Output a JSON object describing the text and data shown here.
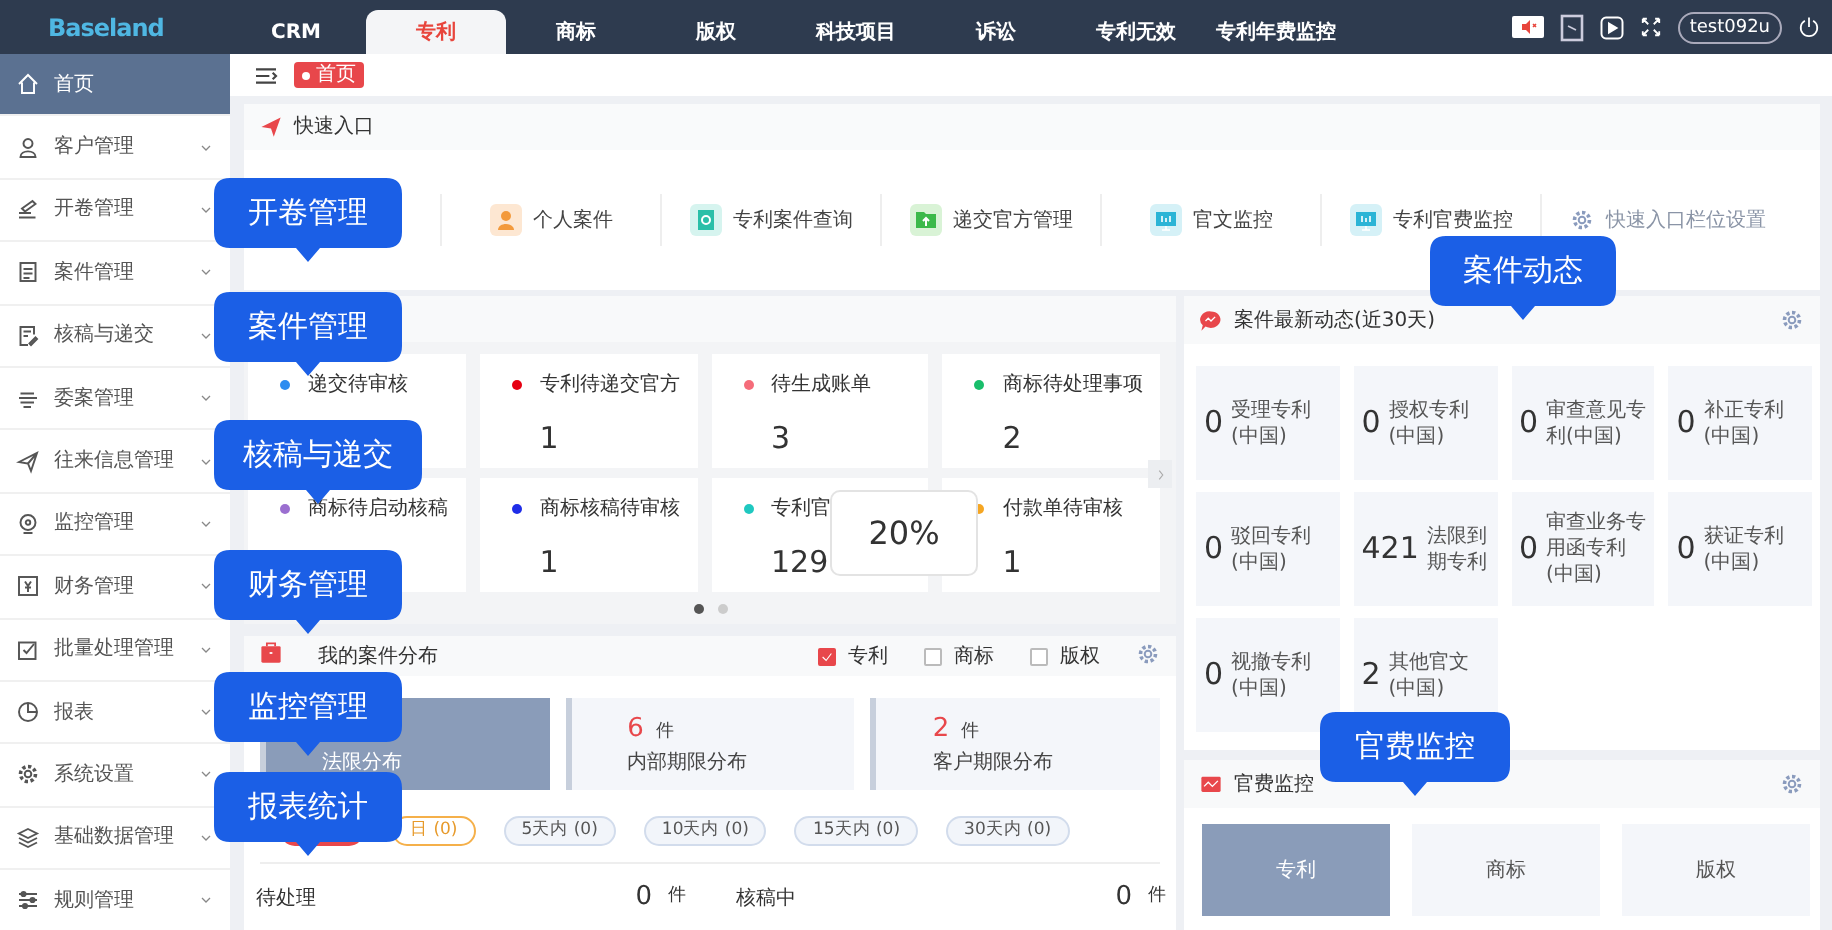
{
  "app": {
    "logo": "Baseland",
    "user": "test092u"
  },
  "top_tabs": [
    {
      "label": "CRM",
      "selected": false
    },
    {
      "label": "专利",
      "selected": true
    },
    {
      "label": "商标",
      "selected": false
    },
    {
      "label": "版权",
      "selected": false
    },
    {
      "label": "科技项目",
      "selected": false
    },
    {
      "label": "诉讼",
      "selected": false
    },
    {
      "label": "专利无效",
      "selected": false
    },
    {
      "label": "专利年费监控",
      "selected": false
    }
  ],
  "sidebar": [
    {
      "label": "首页",
      "selected": true,
      "has_submenu": false
    },
    {
      "label": "客户管理",
      "selected": false,
      "has_submenu": true
    },
    {
      "label": "开卷管理",
      "selected": false,
      "has_submenu": true
    },
    {
      "label": "案件管理",
      "selected": false,
      "has_submenu": true
    },
    {
      "label": "核稿与递交",
      "selected": false,
      "has_submenu": true
    },
    {
      "label": "委案管理",
      "selected": false,
      "has_submenu": true
    },
    {
      "label": "往来信息管理",
      "selected": false,
      "has_submenu": true
    },
    {
      "label": "监控管理",
      "selected": false,
      "has_submenu": true
    },
    {
      "label": "财务管理",
      "selected": false,
      "has_submenu": true
    },
    {
      "label": "批量处理管理",
      "selected": false,
      "has_submenu": true
    },
    {
      "label": "报表",
      "selected": false,
      "has_submenu": true
    },
    {
      "label": "系统设置",
      "selected": false,
      "has_submenu": true
    },
    {
      "label": "基础数据管理",
      "selected": false,
      "has_submenu": true
    },
    {
      "label": "规则管理",
      "selected": false,
      "has_submenu": true
    }
  ],
  "page_tag": "首页",
  "quick_entry": {
    "title": "快速入口",
    "items": [
      {
        "label": "个人案件",
        "kind": "person"
      },
      {
        "label": "专利案件查询",
        "kind": "search"
      },
      {
        "label": "递交官方管理",
        "kind": "folder"
      },
      {
        "label": "官文监控",
        "kind": "monitor"
      },
      {
        "label": "专利官费监控",
        "kind": "monitor"
      }
    ],
    "settings": "快速入口栏位设置"
  },
  "todo": {
    "cards": [
      {
        "label": "递交待审核",
        "color": "#2d8cf0"
      },
      {
        "label": "专利待递交官方",
        "color": "#e60012",
        "value": "1"
      },
      {
        "label": "待生成账单",
        "color": "#f56c7a",
        "value": "3"
      },
      {
        "label": "商标待处理事项",
        "color": "#19be6b",
        "value": "2"
      },
      {
        "label": "商标待启动核稿",
        "color": "#9b6fd0"
      },
      {
        "label": "商标核稿待审核",
        "color": "#1f2de8",
        "value": "1"
      },
      {
        "label": "专利官",
        "color": "#1fc8c0",
        "value": "129"
      },
      {
        "label": "付款单待审核",
        "color": "#f5a623",
        "value": "1"
      }
    ],
    "dots": [
      {
        "selected": true
      },
      {
        "selected": false
      }
    ]
  },
  "distribution": {
    "title": "我的案件分布",
    "filters": [
      {
        "label": "专利",
        "checked": true
      },
      {
        "label": "商标",
        "checked": false
      },
      {
        "label": "版权",
        "checked": false
      }
    ],
    "blocks": [
      {
        "label": "法限分布",
        "selected": true
      },
      {
        "count": "6",
        "unit": "件",
        "label": "内部期限分布",
        "selected": false
      },
      {
        "count": "2",
        "unit": "件",
        "label": "客户期限分布",
        "selected": false
      }
    ],
    "ranges": [
      {
        "selected": true,
        "kind": "plain"
      },
      {
        "label": "日 (0)",
        "selected": false,
        "kind": "highlight"
      },
      {
        "label": "5天内 (0)",
        "selected": false,
        "kind": "plain"
      },
      {
        "label": "10天内 (0)",
        "selected": false,
        "kind": "plain"
      },
      {
        "label": "15天内 (0)",
        "selected": false,
        "kind": "plain"
      },
      {
        "label": "30天内 (0)",
        "selected": false,
        "kind": "plain"
      }
    ],
    "rows": [
      {
        "label": "待处理",
        "count": "0",
        "unit": "件"
      },
      {
        "label": "核稿中",
        "count": "0",
        "unit": "件"
      }
    ]
  },
  "dynamics": {
    "title": "案件最新动态(近30天)",
    "tiles": [
      {
        "count": "0",
        "label": "受理专利(中国)"
      },
      {
        "count": "0",
        "label": "授权专利(中国)"
      },
      {
        "count": "0",
        "label": "审查意见专利(中国)"
      },
      {
        "count": "0",
        "label": "补正专利(中国)"
      },
      {
        "count": "0",
        "label": "驳回专利(中国)"
      },
      {
        "count": "421",
        "label": "法限到期专利"
      },
      {
        "count": "0",
        "label": "审查业务专用函专利(中国)"
      },
      {
        "count": "0",
        "label": "获证专利(中国)"
      },
      {
        "count": "0",
        "label": "视撤专利(中国)"
      },
      {
        "count": "2",
        "label": "其他官文(中国)"
      }
    ]
  },
  "fee_monitor": {
    "title": "官费监控",
    "tiles": [
      {
        "label": "专利",
        "selected": true
      },
      {
        "label": "商标",
        "selected": false
      },
      {
        "label": "版权",
        "selected": false
      }
    ]
  },
  "tooltip": "20%",
  "callouts": [
    "开卷管理",
    "案件管理",
    "核稿与递交",
    "财务管理",
    "监控管理",
    "报表统计",
    "案件动态",
    "官费监控"
  ]
}
